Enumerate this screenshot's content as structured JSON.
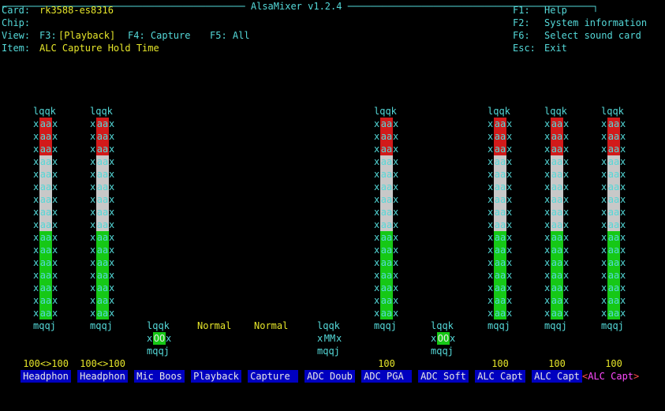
{
  "header": {
    "top_rule": "┌────────────────────────────────────────── AlsaMixer v1.2.4 ───────────────────────────────────────────┐",
    "card_label": "Card:",
    "card_value": "rk3588-es8316",
    "chip_label": "Chip:",
    "chip_value": "",
    "view_label": "View:",
    "view_f3": "F3:",
    "view_playback": "[Playback]",
    "view_f4": "F4: Capture",
    "view_f5": "F5: All",
    "item_label": "Item:",
    "item_value": "ALC Capture Hold Time",
    "help": [
      {
        "key": "F1:",
        "text": "Help"
      },
      {
        "key": "F2:",
        "text": "System information"
      },
      {
        "key": "F6:",
        "text": "Select sound card"
      },
      {
        "key": "Esc:",
        "text": "Exit"
      }
    ]
  },
  "controls": [
    {
      "label": "Headphon",
      "value": "100<>100",
      "type": "bar",
      "level": 1.0
    },
    {
      "label": "Headphon",
      "value": "100<>100",
      "type": "bar",
      "level": 1.0
    },
    {
      "label": "Mic Boos",
      "value": "",
      "type": "switch",
      "state": "OO"
    },
    {
      "label": "Playback",
      "value": "Normal",
      "type": "enum"
    },
    {
      "label": "Capture ",
      "value": "Normal",
      "type": "enum"
    },
    {
      "label": "ADC Doub",
      "value": "",
      "type": "switch",
      "state": "MM"
    },
    {
      "label": "ADC PGA ",
      "value": "100",
      "type": "bar",
      "level": 1.0
    },
    {
      "label": "ADC Soft",
      "value": "",
      "type": "switch",
      "state": "OO"
    },
    {
      "label": "ALC Capt",
      "value": "100",
      "type": "bar",
      "level": 1.0
    },
    {
      "label": "ALC Capt",
      "value": "100",
      "type": "bar",
      "level": 1.0
    },
    {
      "label": "ALC Capt",
      "value": "100",
      "type": "bar",
      "level": 1.0,
      "focused": true
    }
  ],
  "glyphs": {
    "frame_top": "lqqk",
    "frame_bottom": "mqqj",
    "side": "x",
    "fill": "aa"
  }
}
